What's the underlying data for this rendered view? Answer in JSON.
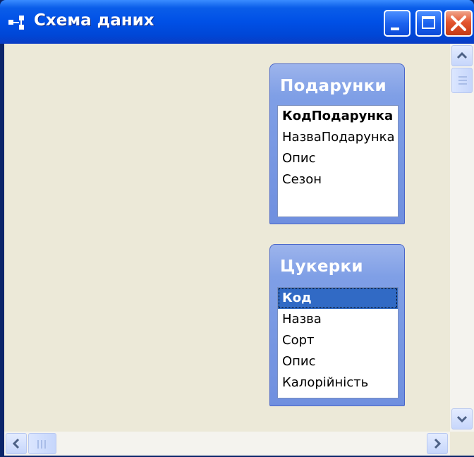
{
  "window": {
    "title": "Схема даних"
  },
  "tables": [
    {
      "title": "Подарунки",
      "fields": [
        {
          "name": "КодПодарунка",
          "primary_key": true,
          "selected": false
        },
        {
          "name": "НазваПодарунка",
          "primary_key": false,
          "selected": false
        },
        {
          "name": "Опис",
          "primary_key": false,
          "selected": false
        },
        {
          "name": "Сезон",
          "primary_key": false,
          "selected": false
        }
      ]
    },
    {
      "title": "Цукерки",
      "fields": [
        {
          "name": "Код",
          "primary_key": true,
          "selected": true
        },
        {
          "name": "Назва",
          "primary_key": false,
          "selected": false
        },
        {
          "name": "Сорт",
          "primary_key": false,
          "selected": false
        },
        {
          "name": "Опис",
          "primary_key": false,
          "selected": false
        },
        {
          "name": "Калорійність",
          "primary_key": false,
          "selected": false
        }
      ]
    }
  ],
  "icons": {
    "window": "relationships-icon",
    "minimize": "minimize-icon",
    "maximize": "maximize-icon",
    "close": "close-icon",
    "scroll_up": "arrow-up-icon",
    "scroll_down": "arrow-down-icon",
    "scroll_left": "arrow-left-icon",
    "scroll_right": "arrow-right-icon"
  },
  "colors": {
    "titlebar": "#0050e6",
    "close_button": "#e4562f",
    "client_background": "#ece9d8",
    "table_header": "#7f9fe6",
    "selection": "#316ac5"
  }
}
